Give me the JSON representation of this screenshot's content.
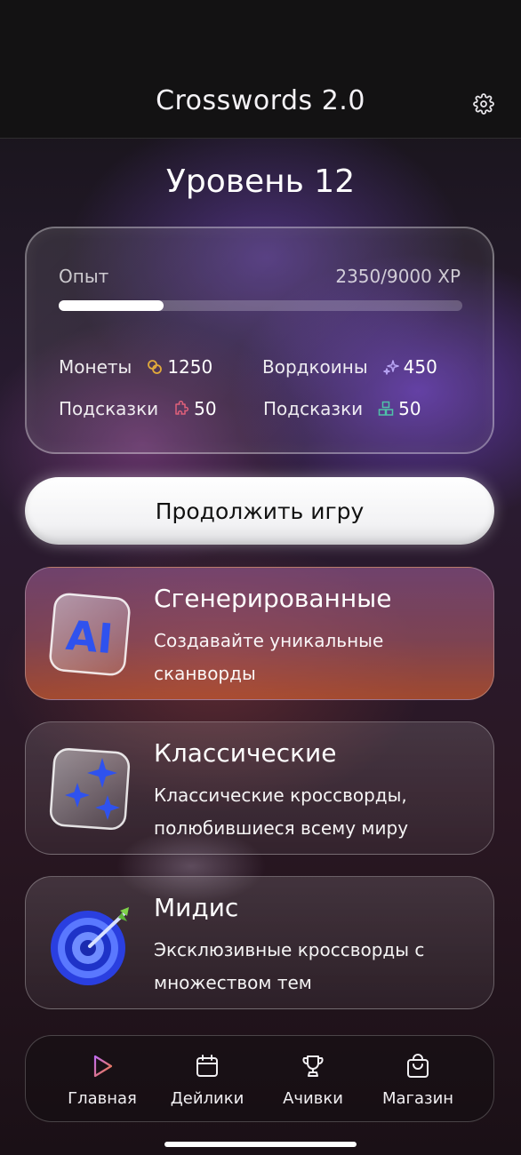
{
  "header": {
    "title": "Crosswords 2.0",
    "settings_icon": "gear-icon"
  },
  "level": {
    "title": "Уровень 12"
  },
  "stats": {
    "xp_label": "Опыт",
    "xp_value": "2350/9000 XP",
    "xp_progress": 0.26,
    "coins": {
      "label": "Монеты",
      "icon": "coins-icon",
      "value": "1250",
      "color": "#e0a93b"
    },
    "wordcoins": {
      "label": "Вордкоины",
      "icon": "sparkle-icon",
      "value": "450",
      "color": "#b9a6f5"
    },
    "hints_left": {
      "label": "Подсказки",
      "icon": "puzzle-icon",
      "value": "50",
      "color": "#e0607a"
    },
    "hints_right": {
      "label": "Подсказки",
      "icon": "blocks-icon",
      "value": "50",
      "color": "#4fc3a8"
    }
  },
  "continue_button": {
    "label": "Продолжить игру"
  },
  "modes": [
    {
      "title": "Сгенерированные",
      "description": "Создавайте уникальные сканворды",
      "icon": "ai-icon"
    },
    {
      "title": "Классические",
      "description": "Классические кроссворды, полюбившиеся всему миру",
      "icon": "stars-icon"
    },
    {
      "title": "Мидис",
      "description": "Эксклюзивные кроссворды с множеством тем",
      "icon": "target-icon"
    }
  ],
  "nav": [
    {
      "label": "Главная",
      "icon": "play-icon",
      "active": true
    },
    {
      "label": "Дейлики",
      "icon": "calendar-icon",
      "active": false
    },
    {
      "label": "Ачивки",
      "icon": "trophy-icon",
      "active": false
    },
    {
      "label": "Магазин",
      "icon": "bag-icon",
      "active": false
    }
  ],
  "colors": {
    "accent": "#e7683e",
    "accent_blue": "#3b5cf0"
  }
}
